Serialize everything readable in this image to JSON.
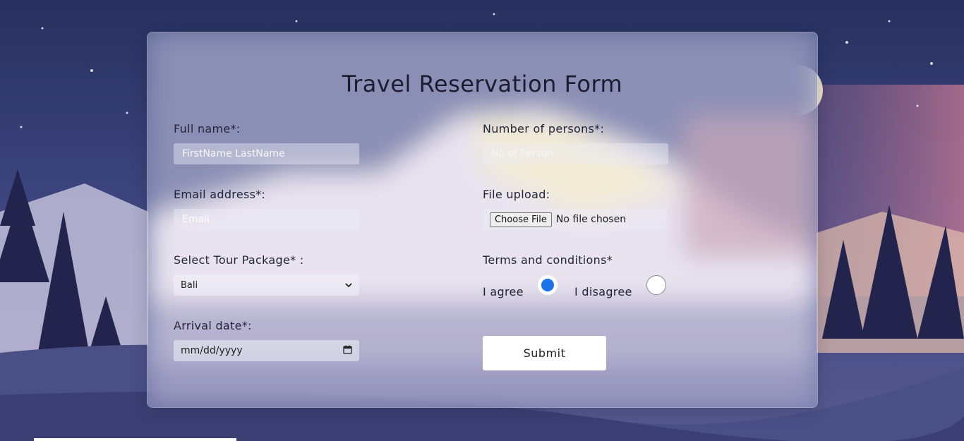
{
  "form": {
    "title": "Travel Reservation Form",
    "full_name": {
      "label": "Full name*:",
      "placeholder": "FirstName LastName"
    },
    "email": {
      "label": "Email address*:",
      "placeholder": "Email"
    },
    "tour_package": {
      "label": "Select Tour Package* :",
      "selected": "Bali"
    },
    "arrival_date": {
      "label": "Arrival date*:",
      "placeholder": "mm/dd/yyyy"
    },
    "persons": {
      "label": "Number of persons*:",
      "placeholder": "No of Person"
    },
    "file_upload": {
      "label": "File upload:",
      "button": "Choose File",
      "status": "No file chosen"
    },
    "terms": {
      "label": "Terms and conditions*",
      "agree": "I agree",
      "disagree": "I disagree",
      "selected": "agree"
    },
    "submit_label": "Submit"
  },
  "icons": {
    "select_arrow": "chevron-down-icon",
    "date_picker": "calendar-icon"
  },
  "colors": {
    "radio_checked": "#1a73e8",
    "button_bg": "#ffffff"
  }
}
